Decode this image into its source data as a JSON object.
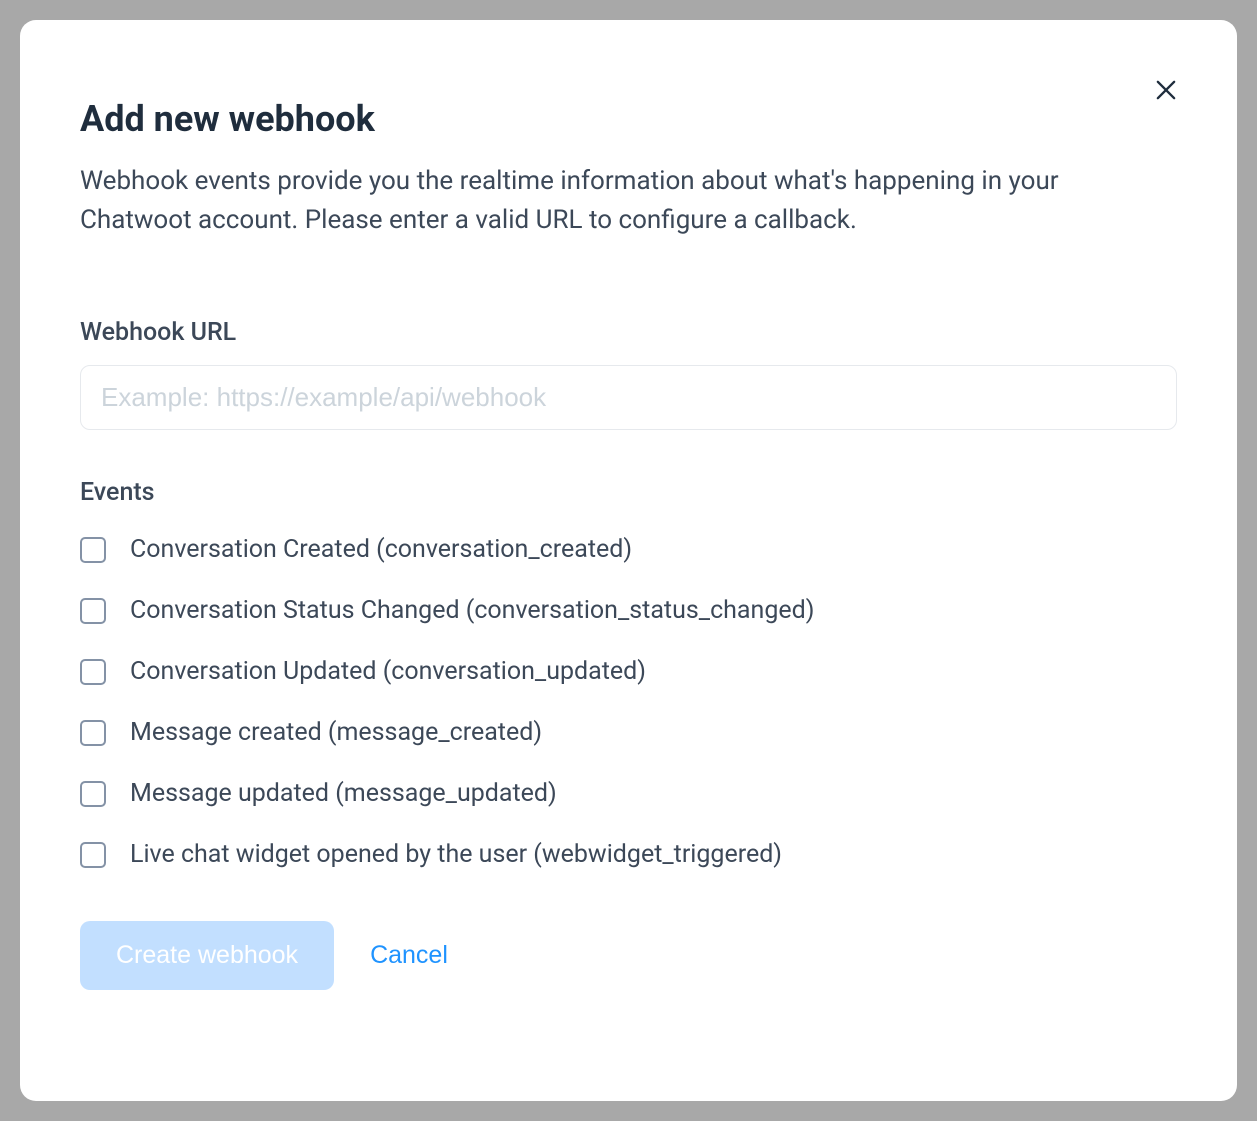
{
  "modal": {
    "title": "Add new webhook",
    "description": "Webhook events provide you the realtime information about what's happening in your Chatwoot account. Please enter a valid URL to configure a callback."
  },
  "form": {
    "url_label": "Webhook URL",
    "url_placeholder": "Example: https://example/api/webhook",
    "url_value": "",
    "events_label": "Events",
    "events": [
      {
        "label": "Conversation Created (conversation_created)",
        "checked": false
      },
      {
        "label": "Conversation Status Changed (conversation_status_changed)",
        "checked": false
      },
      {
        "label": "Conversation Updated (conversation_updated)",
        "checked": false
      },
      {
        "label": "Message created (message_created)",
        "checked": false
      },
      {
        "label": "Message updated (message_updated)",
        "checked": false
      },
      {
        "label": "Live chat widget opened by the user (webwidget_triggered)",
        "checked": false
      }
    ]
  },
  "buttons": {
    "create_label": "Create webhook",
    "cancel_label": "Cancel"
  }
}
